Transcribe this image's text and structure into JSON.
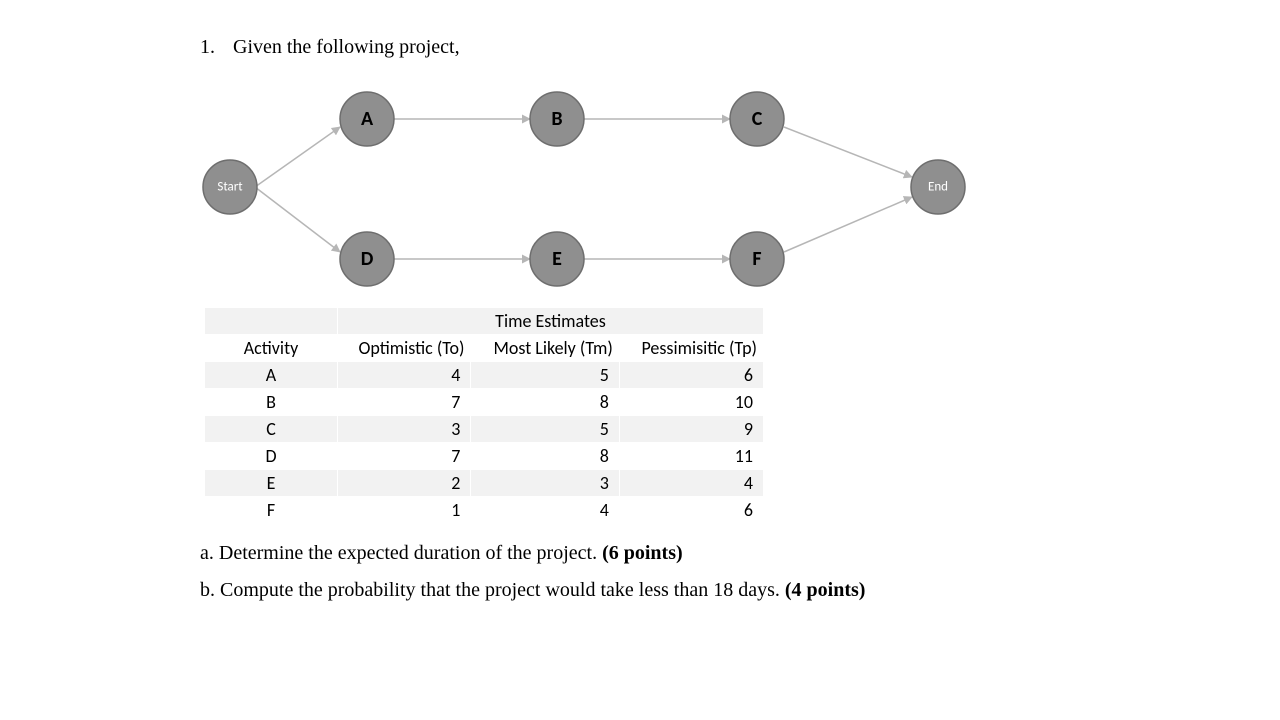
{
  "question": {
    "number": "1.",
    "prompt": "Given the following project,"
  },
  "diagram": {
    "nodes": {
      "start": "Start",
      "A": "A",
      "B": "B",
      "C": "C",
      "D": "D",
      "E": "E",
      "F": "F",
      "end": "End"
    }
  },
  "table": {
    "super_header_blank": "",
    "super_header_estimates": "Time Estimates",
    "headers": {
      "activity": "Activity",
      "to": "Optimistic (To)",
      "tm": "Most Likely (Tm)",
      "tp": "Pessimisitic (Tp)"
    },
    "rows": [
      {
        "activity": "A",
        "to": "4",
        "tm": "5",
        "tp": "6"
      },
      {
        "activity": "B",
        "to": "7",
        "tm": "8",
        "tp": "10"
      },
      {
        "activity": "C",
        "to": "3",
        "tm": "5",
        "tp": "9"
      },
      {
        "activity": "D",
        "to": "7",
        "tm": "8",
        "tp": "11"
      },
      {
        "activity": "E",
        "to": "2",
        "tm": "3",
        "tp": "4"
      },
      {
        "activity": "F",
        "to": "1",
        "tm": "4",
        "tp": "6"
      }
    ]
  },
  "subquestions": {
    "a_prefix": "a. ",
    "a_text": "Determine the expected duration of the project. ",
    "a_points": "(6 points)",
    "b_prefix": "b. ",
    "b_text": "Compute the probability that the project would take less than 18 days. ",
    "b_points": "(4 points)"
  }
}
